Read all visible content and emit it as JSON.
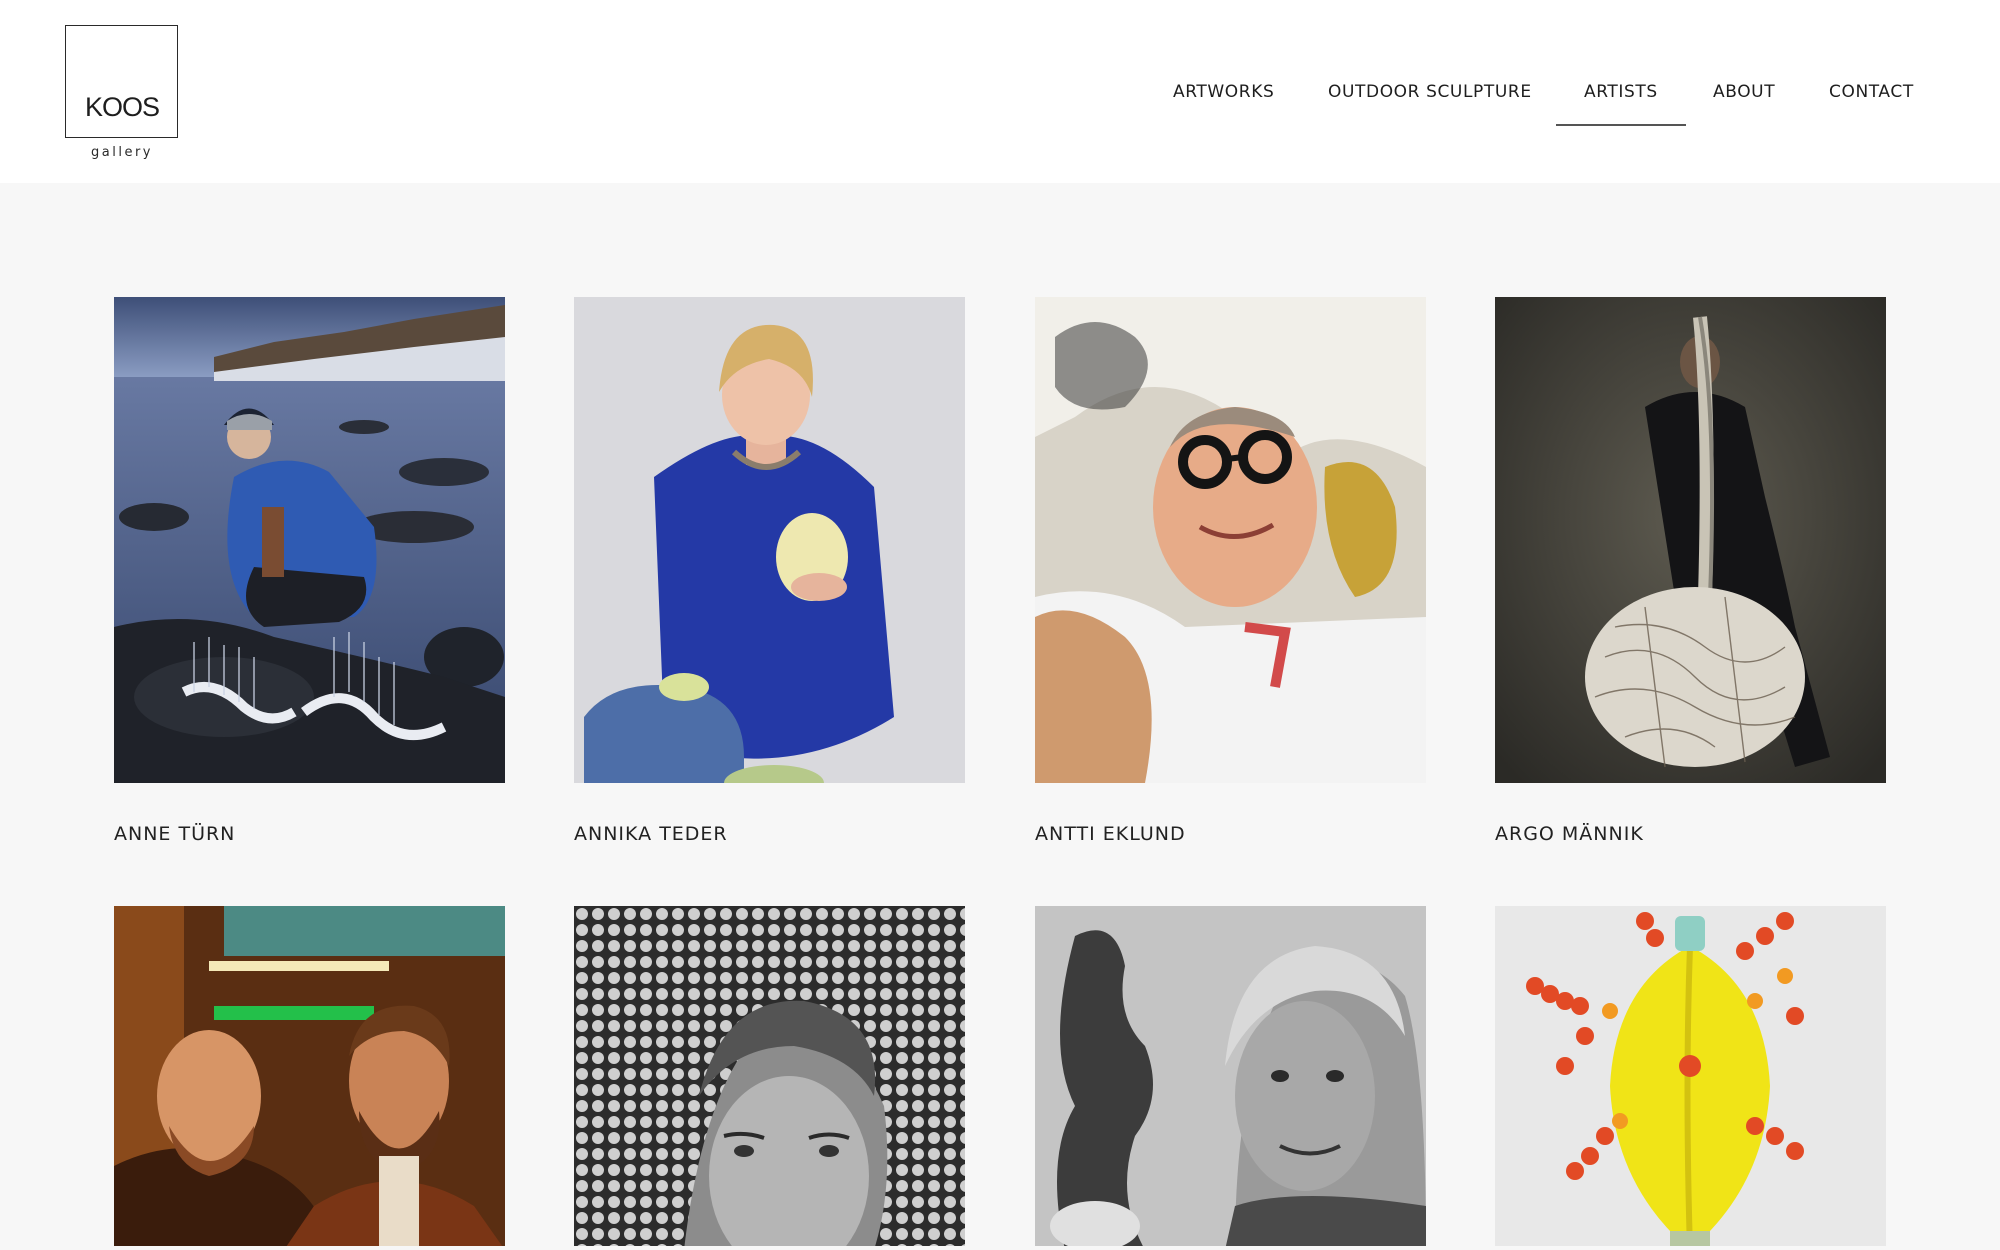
{
  "logo": {
    "mark": "KOOS",
    "sub": "gallery"
  },
  "nav": {
    "items": [
      {
        "label": "ARTWORKS",
        "active": false
      },
      {
        "label": "OUTDOOR SCULPTURE",
        "active": false
      },
      {
        "label": "ARTISTS",
        "active": true
      },
      {
        "label": "ABOUT",
        "active": false
      },
      {
        "label": "CONTACT",
        "active": false
      }
    ]
  },
  "artists": [
    {
      "name": "ANNE TÜRN"
    },
    {
      "name": "ANNIKA TEDER"
    },
    {
      "name": "ANTTI EKLUND"
    },
    {
      "name": "ARGO MÄNNIK"
    },
    {
      "name": ""
    },
    {
      "name": ""
    },
    {
      "name": ""
    },
    {
      "name": ""
    }
  ],
  "colors": {
    "background": "#f7f7f7",
    "header": "#ffffff",
    "text": "#1e1e1e"
  }
}
